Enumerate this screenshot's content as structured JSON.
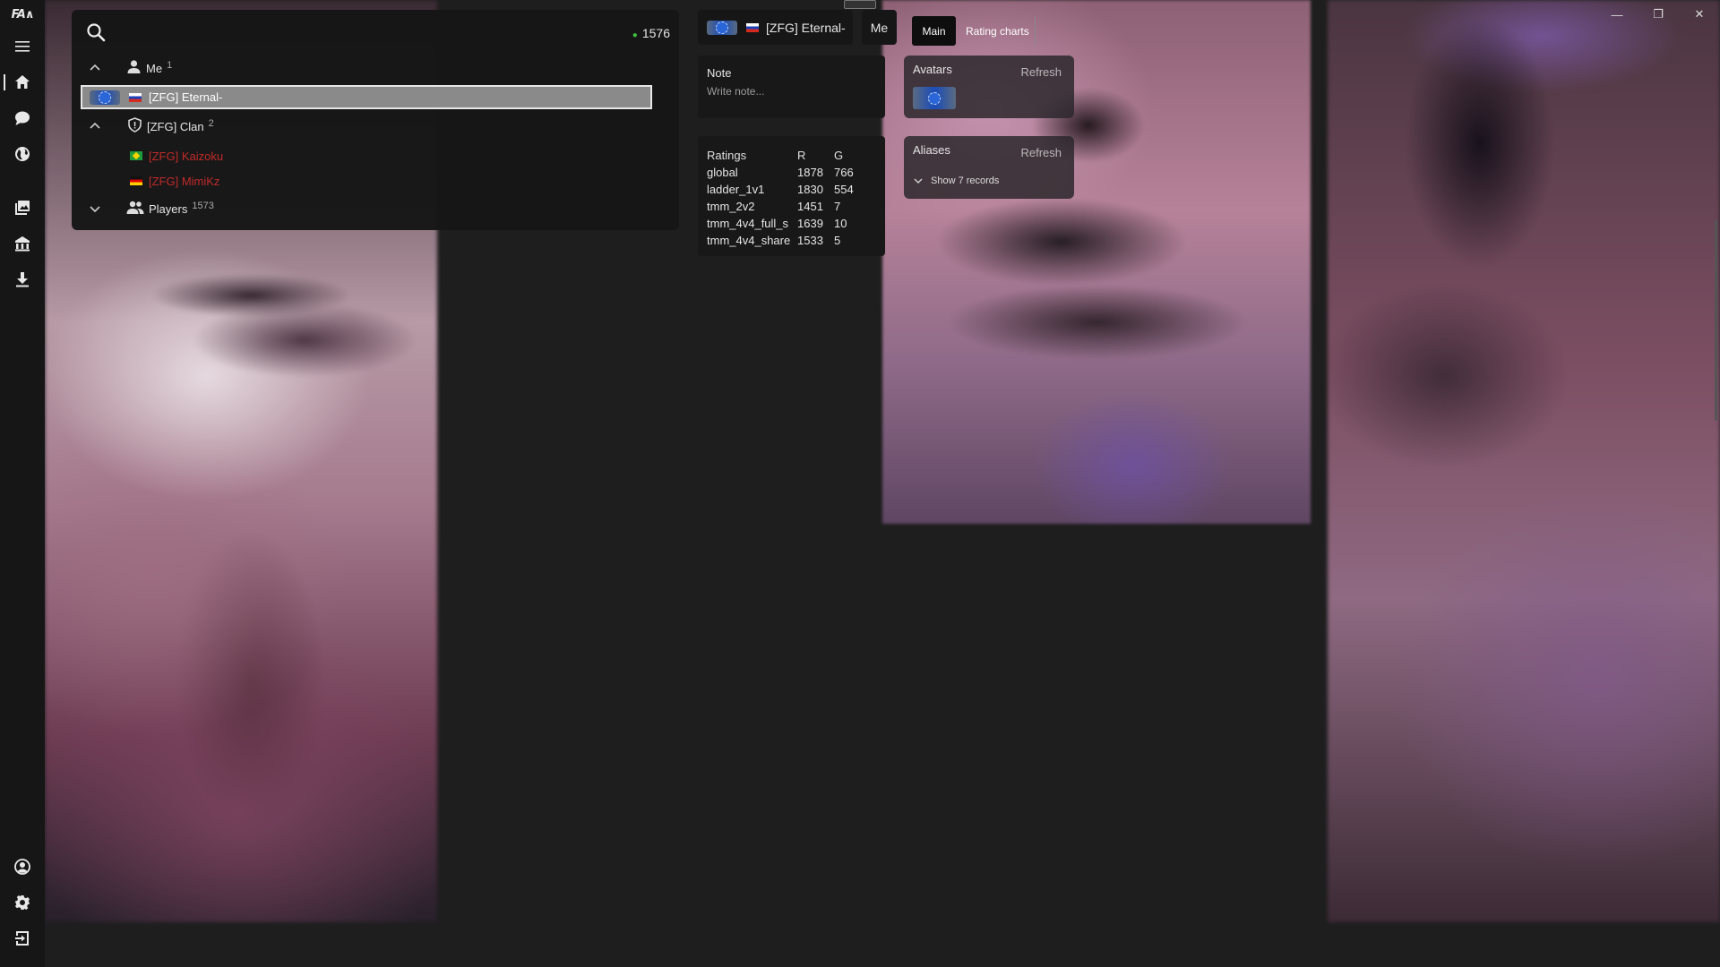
{
  "app": {
    "logo": "FA∧"
  },
  "rail": {
    "top": [
      "menu-icon",
      "home-icon",
      "chat-icon",
      "globe-icon",
      "gallery-icon",
      "vault-icon",
      "download-icon"
    ],
    "bottom": [
      "account-icon",
      "settings-icon",
      "exit-icon"
    ]
  },
  "window_controls": {
    "minimize": "—",
    "restore": "❐",
    "close": "✕"
  },
  "player_list": {
    "online_count": "1576",
    "groups": {
      "me": {
        "label": "Me",
        "count": "1"
      },
      "clan": {
        "label": "[ZFG] Clan",
        "count": "2"
      },
      "players": {
        "label": "Players",
        "count": "1573"
      }
    },
    "selected_player": {
      "name": "[ZFG] Eternal-",
      "country": "RU"
    },
    "clan_members": [
      {
        "name": "[ZFG] Kaizoku",
        "country": "BR"
      },
      {
        "name": "[ZFG] MimiKz",
        "country": "DE"
      }
    ]
  },
  "profile": {
    "name": "[ZFG] Eternal-",
    "me_label": "Me",
    "tabs": {
      "main": "Main",
      "rating_charts": "Rating charts"
    },
    "note": {
      "label": "Note",
      "placeholder": "Write note..."
    },
    "ratings": {
      "headers": [
        "Ratings",
        "R",
        "G"
      ],
      "rows": [
        [
          "global",
          "1878",
          "766"
        ],
        [
          "ladder_1v1",
          "1830",
          "554"
        ],
        [
          "tmm_2v2",
          "1451",
          "7"
        ],
        [
          "tmm_4v4_full_s",
          "1639",
          "10"
        ],
        [
          "tmm_4v4_share",
          "1533",
          "5"
        ]
      ]
    },
    "avatars": {
      "label": "Avatars",
      "refresh": "Refresh"
    },
    "aliases": {
      "label": "Aliases",
      "refresh": "Refresh",
      "show_records": "Show 7 records"
    }
  }
}
